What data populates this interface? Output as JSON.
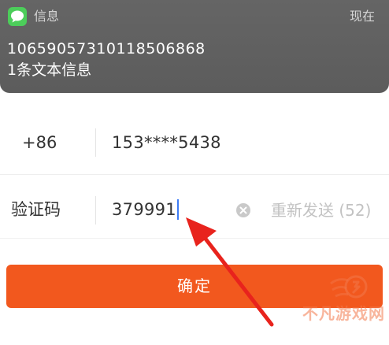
{
  "notification": {
    "app_name": "信息",
    "time": "现在",
    "sender": "10659057310118506868",
    "preview": "1条文本信息",
    "app_icon": "messages-icon"
  },
  "form": {
    "country_code": "+86",
    "phone_masked": "153****5438",
    "code_label": "验证码",
    "code_value": "379991",
    "clear_icon": "clear-icon",
    "resend_label": "重新发送 (52)"
  },
  "confirm_button": {
    "label": "确定"
  },
  "annotation": {
    "type": "red-arrow",
    "color": "#e8231d"
  },
  "watermark": {
    "text": "不凡游戏网",
    "color": "#f2784b"
  },
  "colors": {
    "accent": "#f2581e",
    "notification_bg": "#5f5f5f",
    "messages_green": "#4ccd5a",
    "caret": "#3d7cf5"
  }
}
